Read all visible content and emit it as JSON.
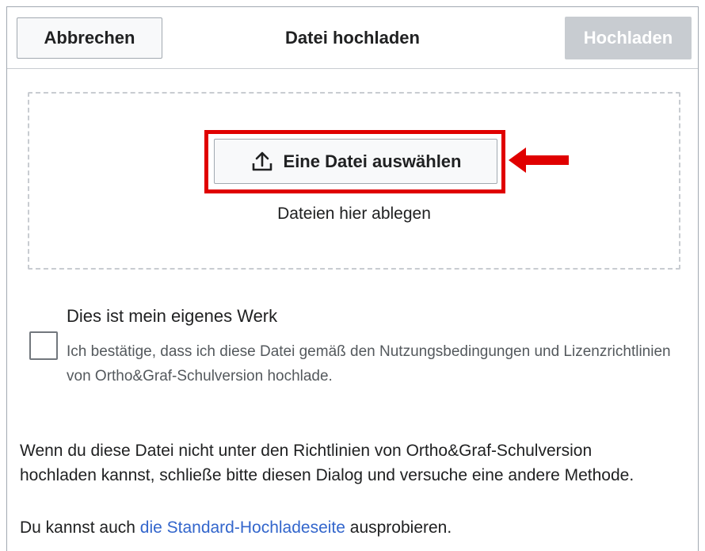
{
  "header": {
    "cancel_label": "Abbrechen",
    "title": "Datei hochladen",
    "upload_label": "Hochladen"
  },
  "dropzone": {
    "select_button_label": "Eine Datei auswählen",
    "drop_text": "Dateien hier ablegen",
    "upload_icon": "upload-icon"
  },
  "own_work": {
    "title": "Dies ist mein eigenes Werk",
    "description": "Ich bestätige, dass ich diese Datei gemäß den Nutzungsbedingungen und Lizenzrichtlinien von Ortho&Graf-Schulversion hochlade.",
    "checked": false
  },
  "info": {
    "paragraph1": "Wenn du diese Datei nicht unter den Richtlinien von Ortho&Graf-Schulversion hochladen kannst, schließe bitte diesen Dialog und versuche eine andere Methode.",
    "paragraph2_prefix": "Du kannst auch ",
    "paragraph2_link": "die Standard-Hochladeseite",
    "paragraph2_suffix": " ausprobieren."
  },
  "colors": {
    "highlight": "#e00000",
    "link": "#3366cc",
    "disabled_button": "#c8ccd1"
  }
}
